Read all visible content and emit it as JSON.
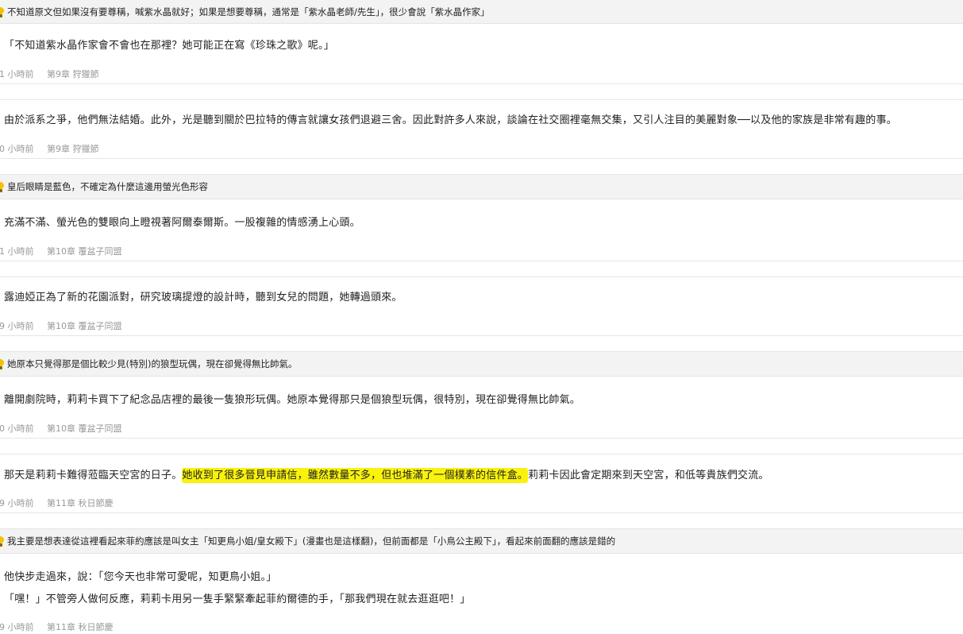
{
  "entries": [
    {
      "note": "不知道原文但如果沒有要尊稱，喊紫水晶就好；如果是想要尊稱，通常是「紫水晶老師/先生」，很少會說「紫水晶作家」",
      "lines": [
        "「不知道紫水晶作家會不會也在那裡？她可能正在寫《珍珠之歌》呢。」"
      ],
      "time": "1 小時前",
      "chapter": "第9章 狩獵節"
    },
    {
      "note": "",
      "lines": [
        "由於派系之爭，他們無法結婚。此外，光是聽到關於巴拉特的傳言就讓女孩們退避三舍。因此對許多人來說，談論在社交圈裡毫無交集，又引人注目的美麗對象──以及他的家族是非常有趣的事。"
      ],
      "time": "0 小時前",
      "chapter": "第9章 狩獵節"
    },
    {
      "note": "皇后眼睛是藍色，不確定為什麼這邊用螢光色形容",
      "lines": [
        "充滿不滿、螢光色的雙眼向上瞪視著阿爾泰爾斯。一股複雜的情感湧上心頭。"
      ],
      "time": "1 小時前",
      "chapter": "第10章 覆盆子同盟"
    },
    {
      "note": "",
      "lines": [
        "露迪婭正為了新的花園派對，研究玻璃提燈的設計時，聽到女兒的問題，她轉過頭來。"
      ],
      "time": "9 小時前",
      "chapter": "第10章 覆盆子同盟"
    },
    {
      "note": "她原本只覺得那是個比較少見(特別)的狼型玩偶，現在卻覺得無比帥氣。",
      "lines": [
        "離開劇院時，莉莉卡買下了紀念品店裡的最後一隻狼形玩偶。她原本覺得那只是個狼型玩偶，很特別，現在卻覺得無比帥氣。"
      ],
      "time": "0 小時前",
      "chapter": "第10章 覆盆子同盟"
    },
    {
      "note": "",
      "line_before": "那天是莉莉卡難得蒞臨天空宮的日子。",
      "line_highlight": "她收到了很多晉見申請信，雖然數量不多，但也堆滿了一個樸素的信件盒。",
      "line_after": "莉莉卡因此會定期來到天空宮，和低等貴族們交流。",
      "time": "9 小時前",
      "chapter": "第11章 秋日節慶"
    },
    {
      "note": "我主要是想表達從這裡看起來菲約應該是叫女主「知更鳥小姐/皇女殿下」(漫畫也是這樣翻)，但前面都是「小鳥公主殿下」，看起來前面翻的應該是錯的",
      "lines": [
        "他快步走過來，說：「您今天也非常可愛呢，知更鳥小姐。」",
        "「嘿！」不管旁人做何反應，莉莉卡用另一隻手緊緊牽起菲約爾德的手，「那我們現在就去逛逛吧！」"
      ],
      "time": "9 小時前",
      "chapter": "第11章 秋日節慶"
    }
  ],
  "colors": {
    "highlight": "#f8f20d",
    "note_bar_bg": "#f3f3f3",
    "meta_text": "#999999",
    "bulb": "#f2c200"
  },
  "icons": {
    "note": "lightbulb-icon"
  }
}
